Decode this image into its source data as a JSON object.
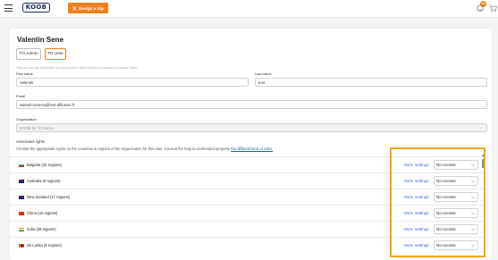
{
  "header": {
    "logo_text": "KOOB",
    "design_trip_label": "Design a trip",
    "notification_count": "20"
  },
  "page": {
    "title": "Valentin Sene",
    "roles": [
      "TO Admin",
      "TO User"
    ],
    "active_role": "TO User",
    "info_text": "This user can see information but cannot edit or delete anything or preserve operators' datas."
  },
  "form": {
    "first_name_label": "First name",
    "first_name_value": "Valentin",
    "last_name_label": "Last name",
    "last_name_value": "test",
    "email_label": "Email",
    "email_value": "valentin.test+to@test-diffusion.fr",
    "organization_label": "Organization",
    "organization_value": "KOOB for TO Demo"
  },
  "rights": {
    "title": "Associated rights",
    "help_text": "Choose the appropriate rights on the countries & regions of the organization for this user. Consult the help to understand properly ",
    "help_link": "the different kind of roles.",
    "more_settings_label": "More settings",
    "rows": [
      {
        "country": "Bulgaria (32 regions)",
        "access": "No Access",
        "flag": "bulgaria-flag"
      },
      {
        "country": "Australia (8 regions)",
        "access": "No Access",
        "flag": "australia-flag"
      },
      {
        "country": "New Zealand (17 regions)",
        "access": "No Access",
        "flag": "new-zealand-flag"
      },
      {
        "country": "China (42 regions)",
        "access": "No Access",
        "flag": "china-flag"
      },
      {
        "country": "India (28 regions)",
        "access": "No Access",
        "flag": "india-flag"
      },
      {
        "country": "Sri Lanka (9 regions)",
        "access": "No Access",
        "flag": "sri-lanka-flag"
      }
    ]
  },
  "colors": {
    "accent": "#f07f1d",
    "link": "#3a72c4",
    "highlight": "#f6a21c"
  }
}
